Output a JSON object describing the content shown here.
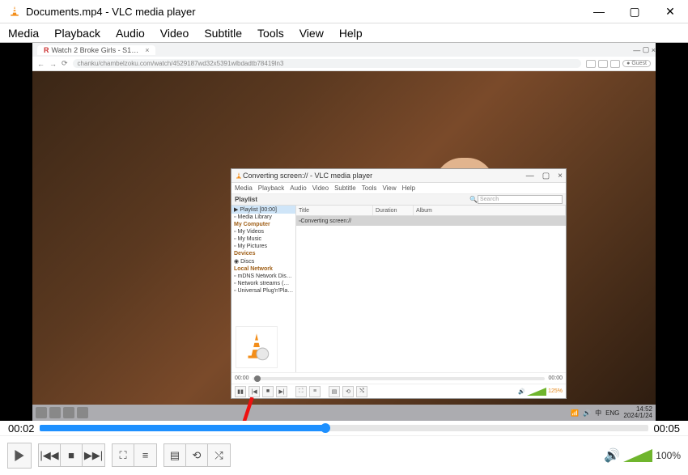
{
  "window": {
    "title": "Documents.mp4 - VLC media player",
    "min": "—",
    "max": "▢",
    "close": "✕"
  },
  "menubar": [
    "Media",
    "Playback",
    "Audio",
    "Video",
    "Subtitle",
    "Tools",
    "View",
    "Help"
  ],
  "chrome_tab": {
    "label": "Watch 2 Broke Girls - S1…",
    "close": "×",
    "url": "chanku/chambelzoku.com/watch/4529187wd32x5391wlbdadtb78419ln3",
    "guest": "Guest",
    "nav_back": "←",
    "nav_fwd": "→",
    "nav_reload": "⟳"
  },
  "taskbar": {
    "wifi": "📶",
    "snd": "🔊",
    "kbd": "中",
    "lang": "ENG",
    "time": "14:52",
    "date": "2024/1/24"
  },
  "inner_vlc": {
    "title": "Converting screen:// - VLC media player",
    "menubar": [
      "Media",
      "Playback",
      "Audio",
      "Video",
      "Subtitle",
      "Tools",
      "View",
      "Help"
    ],
    "playlist_header": "Playlist",
    "search_icon": "🔍",
    "search_ph": "Search",
    "sidebar": {
      "playlist": "Playlist [00:00]",
      "library": "Media Library",
      "my_computer": "My Computer",
      "my_videos": "My Videos",
      "my_music": "My Music",
      "my_pictures": "My Pictures",
      "devices": "Devices",
      "discs": "Discs",
      "local_network": "Local Network",
      "mdns": "mDNS Network Dis…",
      "streams": "Network streams (…",
      "upnp": "Universal Plug'n'Pla…"
    },
    "columns": {
      "title": "Title",
      "duration": "Duration",
      "album": "Album"
    },
    "row": "Converting screen://",
    "time_left": "00:00",
    "time_right": "00:00",
    "vol_label": "125%"
  },
  "seek": {
    "left": "00:02",
    "right": "00:05",
    "pct": 47
  },
  "controls": {
    "volume_pct": "100%"
  }
}
